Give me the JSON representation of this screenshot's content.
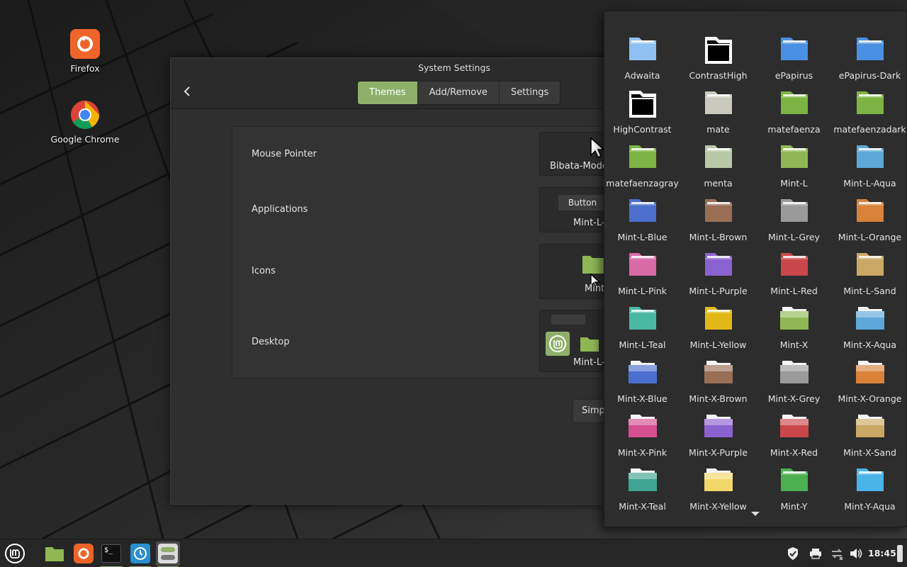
{
  "desktop": {
    "icons": [
      {
        "label": "Firefox",
        "icon": "firefox-icon"
      },
      {
        "label": "Google Chrome",
        "icon": "chrome-icon"
      }
    ]
  },
  "settings": {
    "title": "System Settings",
    "tabs": [
      {
        "label": "Themes",
        "active": true
      },
      {
        "label": "Add/Remove",
        "active": false
      },
      {
        "label": "Settings",
        "active": false
      }
    ],
    "rows": [
      {
        "label": "Mouse Pointer",
        "value": "Bibata-Mode"
      },
      {
        "label": "Applications",
        "value": "Mint-L-",
        "sample_button": "Button"
      },
      {
        "label": "Icons",
        "value": "Mint"
      },
      {
        "label": "Desktop",
        "value": "Mint-L-"
      }
    ],
    "simplified_button": "Simp"
  },
  "icon_themes": [
    {
      "name": "Adwaita",
      "color": "#8ec1f2",
      "style": "flat"
    },
    {
      "name": "ContrastHigh",
      "color": "#000000",
      "style": "contrast"
    },
    {
      "name": "ePapirus",
      "color": "#4a90e2",
      "style": "flat"
    },
    {
      "name": "ePapirus-Dark",
      "color": "#4a90e2",
      "style": "flat"
    },
    {
      "name": "HighContrast",
      "color": "#000000",
      "style": "contrast"
    },
    {
      "name": "mate",
      "color": "#c9c9bd",
      "style": "flat"
    },
    {
      "name": "matefaenza",
      "color": "#7cb342",
      "style": "flat"
    },
    {
      "name": "matefaenzadark",
      "color": "#7cb342",
      "style": "flat"
    },
    {
      "name": "matefaenzagray",
      "color": "#7cb342",
      "style": "flat"
    },
    {
      "name": "menta",
      "color": "#b9c8a6",
      "style": "flat"
    },
    {
      "name": "Mint-L",
      "color": "#8fb855",
      "style": "flat"
    },
    {
      "name": "Mint-L-Aqua",
      "color": "#5da8d8",
      "style": "flat"
    },
    {
      "name": "Mint-L-Blue",
      "color": "#4c6fcf",
      "style": "flat"
    },
    {
      "name": "Mint-L-Brown",
      "color": "#9a6e55",
      "style": "flat"
    },
    {
      "name": "Mint-L-Grey",
      "color": "#9a9a9a",
      "style": "flat"
    },
    {
      "name": "Mint-L-Orange",
      "color": "#d9823a",
      "style": "flat"
    },
    {
      "name": "Mint-L-Pink",
      "color": "#d86aa6",
      "style": "flat"
    },
    {
      "name": "Mint-L-Purple",
      "color": "#8a62cf",
      "style": "flat"
    },
    {
      "name": "Mint-L-Red",
      "color": "#c9474a",
      "style": "flat"
    },
    {
      "name": "Mint-L-Sand",
      "color": "#c9a865",
      "style": "flat"
    },
    {
      "name": "Mint-L-Teal",
      "color": "#4ab9a4",
      "style": "flat"
    },
    {
      "name": "Mint-L-Yellow",
      "color": "#e2b816",
      "style": "flat"
    },
    {
      "name": "Mint-X",
      "color": "#8fb855",
      "style": "gloss"
    },
    {
      "name": "Mint-X-Aqua",
      "color": "#5da8d8",
      "style": "gloss"
    },
    {
      "name": "Mint-X-Blue",
      "color": "#4c6fcf",
      "style": "gloss"
    },
    {
      "name": "Mint-X-Brown",
      "color": "#9a6e55",
      "style": "gloss"
    },
    {
      "name": "Mint-X-Grey",
      "color": "#9a9a9a",
      "style": "gloss"
    },
    {
      "name": "Mint-X-Orange",
      "color": "#d9823a",
      "style": "gloss"
    },
    {
      "name": "Mint-X-Pink",
      "color": "#d44f8e",
      "style": "gloss"
    },
    {
      "name": "Mint-X-Purple",
      "color": "#8a62cf",
      "style": "gloss"
    },
    {
      "name": "Mint-X-Red",
      "color": "#c9474a",
      "style": "gloss"
    },
    {
      "name": "Mint-X-Sand",
      "color": "#c9a865",
      "style": "gloss"
    },
    {
      "name": "Mint-X-Teal",
      "color": "#3fa592",
      "style": "gloss"
    },
    {
      "name": "Mint-X-Yellow",
      "color": "#f2d76b",
      "style": "gloss"
    },
    {
      "name": "Mint-Y",
      "color": "#4caf50",
      "style": "flat"
    },
    {
      "name": "Mint-Y-Aqua",
      "color": "#4ab3e8",
      "style": "flat"
    }
  ],
  "taskbar": {
    "items": [
      "menu-icon",
      "files-icon",
      "firefox-icon",
      "terminal-icon",
      "timeshift-icon",
      "settings-icon"
    ],
    "clock": "18:45"
  },
  "colors": {
    "accent": "#8fb06b",
    "window_bg": "#2f2f2f",
    "panel_bg": "#262626"
  }
}
